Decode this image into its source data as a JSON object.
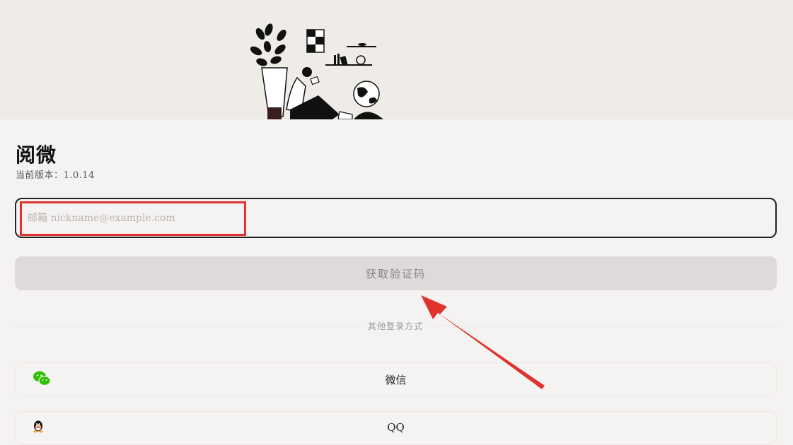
{
  "app": {
    "title": "阅微",
    "version": "当前版本：1.0.14"
  },
  "email": {
    "placeholder": "邮箱 nickname@example.com",
    "value": ""
  },
  "actions": {
    "get_code_label": "获取验证码"
  },
  "other_login": {
    "divider_label": "其他登录方式",
    "options": [
      {
        "label": "微信",
        "icon": "wechat-icon"
      },
      {
        "label": "QQ",
        "icon": "qq-icon"
      }
    ]
  },
  "colors": {
    "background": "#f5f3f2",
    "hero_background": "#efece7",
    "button_disabled": "#dedada",
    "annotation_red": "#e0332e",
    "wechat_green": "#2dc100"
  }
}
